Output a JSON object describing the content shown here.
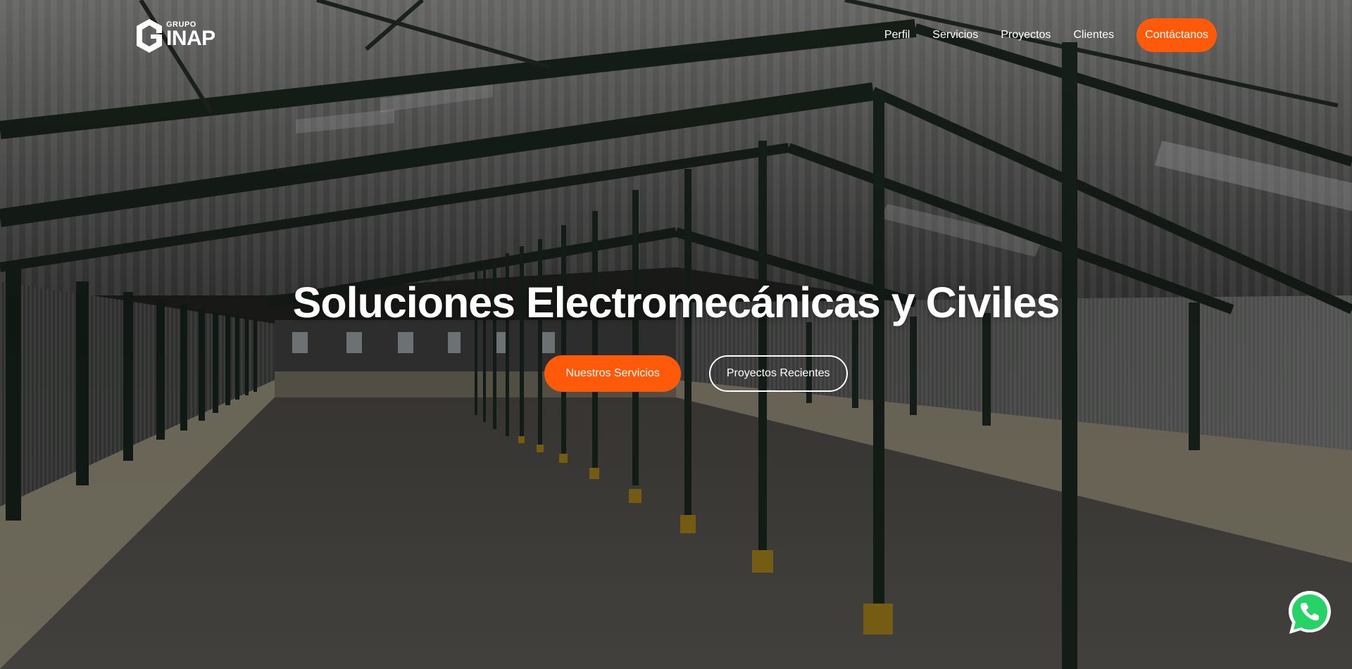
{
  "brand": {
    "small": "GRUPO",
    "big": "INAP"
  },
  "nav": {
    "links": [
      "Perfil",
      "Servicios",
      "Proyectos",
      "Clientes"
    ],
    "cta": "Contáctanos"
  },
  "hero": {
    "title": "Soluciones Electromecánicas y Civiles",
    "primary_button": "Nuestros Servicios",
    "secondary_button": "Proyectos Recientes"
  },
  "colors": {
    "accent": "#ff5a0a",
    "text": "#ffffff"
  },
  "icons": {
    "logo": "grupo-inap-logo-mark",
    "whatsapp": "whatsapp-icon"
  }
}
